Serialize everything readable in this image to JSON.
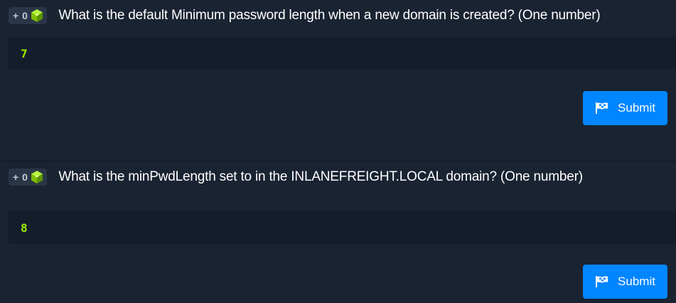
{
  "questions": [
    {
      "points": "+ 0",
      "text": "What is the default Minimum password length when a new domain is created? (One number)",
      "answer": "7",
      "submit_label": "Submit"
    },
    {
      "points": "+ 0",
      "text": "What is the minPwdLength set to in the INLANEFREIGHT.LOCAL domain? (One number)",
      "answer": "8",
      "submit_label": "Submit"
    }
  ],
  "colors": {
    "background": "#1a2332",
    "answer_bg": "#141d2b",
    "answer_text": "#9fef00",
    "button": "#0086ff",
    "badge_bg": "#2a3647",
    "cube": "#9fef00"
  },
  "icons": {
    "badge": "cube-icon",
    "submit": "flag-icon"
  }
}
